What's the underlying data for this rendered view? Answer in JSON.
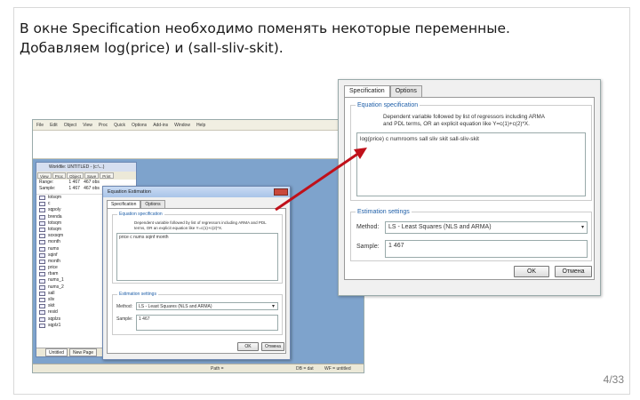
{
  "slide": {
    "caption_line1": "В окне Specification необходимо поменять некоторые переменные.",
    "caption_line2": "Добавляем log(price) и (sall-sliv-skit).",
    "page_number": "4/33"
  },
  "eviews": {
    "menu": [
      "File",
      "Edit",
      "Object",
      "View",
      "Proc",
      "Quick",
      "Options",
      "Add-ins",
      "Window",
      "Help"
    ],
    "workfile": {
      "title": "Workfile: UNTITLED - (c:\\...)",
      "buttons": [
        "View",
        "Proc",
        "Object",
        "Save",
        "Print",
        "Details+/-"
      ],
      "range_label": "Range:",
      "range_value": "1 467",
      "range_obs": "467 obs",
      "sample_label": "Sample:",
      "sample_value": "1 467",
      "sample_obs": "467 obs",
      "items": [
        "totsqm",
        "c",
        "sqpoly",
        "brenda",
        "totsqm",
        "totsqm",
        "soxsqm",
        "month",
        "nums",
        "sqinf",
        "month",
        "price",
        "rbam",
        "nums_1",
        "nums_2",
        "sall",
        "sliv",
        "skit",
        "resid",
        "sqplzs",
        "sqplz1"
      ],
      "tabs": [
        "Untitled",
        "New Page"
      ],
      "active_tab": "Untitled"
    },
    "status_bar": {
      "path": "Path = ",
      "db": "DB = dat",
      "wf": "WF = untitled"
    }
  },
  "small_dialog": {
    "title": "Equation Estimation",
    "tabs": [
      "Specification",
      "Options"
    ],
    "active_tab": "Specification",
    "spec_group_label": "Equation specification",
    "spec_desc": "Dependent variable followed by list of regressors including ARMA and PDL terms, OR an explicit equation like Y=c(1)+c(2)*X.",
    "equation": "price c nums sqinf month",
    "estimation_group_label": "Estimation settings",
    "method_label": "Method:",
    "method_value": "LS - Least Squares (NLS and ARMA)",
    "sample_label": "Sample:",
    "sample_value": "1 467",
    "ok_label": "OK",
    "cancel_label": "Отмена"
  },
  "big_dialog": {
    "tabs": [
      "Specification",
      "Options"
    ],
    "active_tab": "Specification",
    "spec_group_label": "Equation specification",
    "spec_desc_line1": "Dependent variable followed by list of regressors including ARMA",
    "spec_desc_line2": "and PDL terms, OR an explicit equation like Y=c(1)+c(2)*X.",
    "equation": "log(price) c numrooms sall sliv skit sall-sliv-skit",
    "estimation_group_label": "Estimation settings",
    "method_label": "Method:",
    "method_value": "LS - Least Squares (NLS and ARMA)",
    "sample_label": "Sample:",
    "sample_value": "1 467",
    "ok_label": "OK",
    "cancel_label": "Отмена"
  },
  "colors": {
    "arrow": "#c0101a",
    "group_label": "#1f5fa8",
    "desktop": "#7ea3cc"
  }
}
